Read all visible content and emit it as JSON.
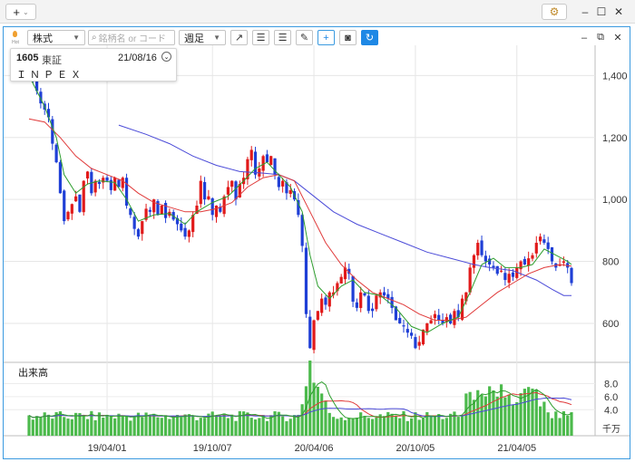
{
  "titlebar": {
    "add_label": "+",
    "add_caret": "⌄",
    "window_buttons": [
      "–",
      "☐",
      "✕"
    ]
  },
  "toolbar": {
    "hot_label": "Hot",
    "market_select": "株式",
    "search_placeholder": "銘柄名 or コード",
    "period_select": "週足",
    "panel_buttons": [
      "–",
      "⧉",
      "✕"
    ]
  },
  "info": {
    "code": "1605",
    "market": "東証",
    "date": "21/08/16",
    "name": "ＩＮＰＥＸ"
  },
  "volume_panel": {
    "label": "出来高",
    "unit": "千万",
    "ticks": [
      "8.0",
      "6.0",
      "4.0"
    ]
  },
  "colors": {
    "up_candle": "#e11a1a",
    "down_candle": "#1f3fd6",
    "ma_short": "#2e9e2e",
    "ma_mid": "#e03a3a",
    "ma_long": "#4b4bd8",
    "volume_bar": "#4cba4c",
    "accent": "#3a9ae0"
  },
  "chart_data": {
    "type": "candlestick",
    "y_ticks": [
      1400,
      1200,
      1000,
      800,
      600
    ],
    "ylim": [
      480,
      1480
    ],
    "x_ticks": [
      {
        "label": "19/04/01",
        "index": 20
      },
      {
        "label": "19/10/07",
        "index": 47
      },
      {
        "label": "20/04/06",
        "index": 73
      },
      {
        "label": "20/10/05",
        "index": 99
      },
      {
        "label": "21/04/05",
        "index": 125
      }
    ],
    "close_path": [
      [
        0,
        1410
      ],
      [
        1,
        1380
      ],
      [
        2,
        1350
      ],
      [
        3,
        1310
      ],
      [
        4,
        1290
      ],
      [
        5,
        1265
      ],
      [
        6,
        1180
      ],
      [
        7,
        1120
      ],
      [
        8,
        1020
      ],
      [
        9,
        930
      ],
      [
        10,
        960
      ],
      [
        11,
        985
      ],
      [
        12,
        1010
      ],
      [
        13,
        960
      ],
      [
        14,
        1060
      ],
      [
        15,
        1090
      ],
      [
        16,
        1020
      ],
      [
        17,
        1060
      ],
      [
        18,
        1050
      ],
      [
        19,
        1070
      ],
      [
        20,
        1060
      ],
      [
        21,
        1030
      ],
      [
        22,
        1070
      ],
      [
        23,
        1040
      ],
      [
        24,
        1070
      ],
      [
        25,
        980
      ],
      [
        26,
        950
      ],
      [
        27,
        905
      ],
      [
        28,
        880
      ],
      [
        29,
        930
      ],
      [
        30,
        970
      ],
      [
        31,
        960
      ],
      [
        32,
        1000
      ],
      [
        33,
        950
      ],
      [
        34,
        980
      ],
      [
        35,
        940
      ],
      [
        36,
        960
      ],
      [
        37,
        935
      ],
      [
        38,
        920
      ],
      [
        39,
        900
      ],
      [
        40,
        880
      ],
      [
        41,
        900
      ],
      [
        42,
        950
      ],
      [
        43,
        980
      ],
      [
        44,
        1060
      ],
      [
        45,
        1000
      ],
      [
        46,
        1010
      ],
      [
        47,
        950
      ],
      [
        48,
        980
      ],
      [
        49,
        960
      ],
      [
        50,
        1010
      ],
      [
        51,
        1040
      ],
      [
        52,
        1060
      ],
      [
        53,
        1000
      ],
      [
        54,
        1050
      ],
      [
        55,
        1070
      ],
      [
        56,
        1130
      ],
      [
        57,
        1160
      ],
      [
        58,
        1080
      ],
      [
        59,
        1100
      ],
      [
        60,
        1140
      ],
      [
        61,
        1120
      ],
      [
        62,
        1140
      ],
      [
        63,
        1080
      ],
      [
        64,
        1040
      ],
      [
        65,
        1060
      ],
      [
        66,
        1020
      ],
      [
        67,
        1030
      ],
      [
        68,
        1000
      ],
      [
        69,
        950
      ],
      [
        70,
        850
      ],
      [
        71,
        630
      ],
      [
        72,
        520
      ],
      [
        73,
        610
      ],
      [
        74,
        640
      ],
      [
        75,
        680
      ],
      [
        76,
        660
      ],
      [
        77,
        700
      ],
      [
        78,
        700
      ],
      [
        79,
        730
      ],
      [
        80,
        750
      ],
      [
        81,
        780
      ],
      [
        82,
        760
      ],
      [
        83,
        670
      ],
      [
        84,
        650
      ],
      [
        85,
        700
      ],
      [
        86,
        690
      ],
      [
        87,
        640
      ],
      [
        88,
        640
      ],
      [
        89,
        690
      ],
      [
        90,
        700
      ],
      [
        91,
        690
      ],
      [
        92,
        680
      ],
      [
        93,
        650
      ],
      [
        94,
        610
      ],
      [
        95,
        600
      ],
      [
        96,
        590
      ],
      [
        97,
        570
      ],
      [
        98,
        560
      ],
      [
        99,
        520
      ],
      [
        100,
        540
      ],
      [
        101,
        580
      ],
      [
        102,
        600
      ],
      [
        103,
        610
      ],
      [
        104,
        630
      ],
      [
        105,
        610
      ],
      [
        106,
        600
      ],
      [
        107,
        620
      ],
      [
        108,
        600
      ],
      [
        109,
        640
      ],
      [
        110,
        620
      ],
      [
        111,
        680
      ],
      [
        112,
        700
      ],
      [
        113,
        780
      ],
      [
        114,
        820
      ],
      [
        115,
        860
      ],
      [
        116,
        820
      ],
      [
        117,
        800
      ],
      [
        118,
        790
      ],
      [
        119,
        780
      ],
      [
        120,
        760
      ],
      [
        121,
        770
      ],
      [
        122,
        740
      ],
      [
        123,
        760
      ],
      [
        124,
        750
      ],
      [
        125,
        780
      ],
      [
        126,
        800
      ],
      [
        127,
        790
      ],
      [
        128,
        810
      ],
      [
        129,
        820
      ],
      [
        130,
        860
      ],
      [
        131,
        880
      ],
      [
        132,
        860
      ],
      [
        133,
        840
      ],
      [
        134,
        800
      ],
      [
        135,
        780
      ],
      [
        136,
        790
      ],
      [
        137,
        800
      ],
      [
        138,
        780
      ],
      [
        139,
        730
      ]
    ],
    "ma_short_path": [
      [
        0,
        1400
      ],
      [
        4,
        1300
      ],
      [
        7,
        1200
      ],
      [
        9,
        1080
      ],
      [
        12,
        1020
      ],
      [
        15,
        1050
      ],
      [
        18,
        1060
      ],
      [
        22,
        1055
      ],
      [
        25,
        1000
      ],
      [
        28,
        930
      ],
      [
        32,
        950
      ],
      [
        36,
        955
      ],
      [
        40,
        920
      ],
      [
        43,
        960
      ],
      [
        47,
        990
      ],
      [
        51,
        1010
      ],
      [
        55,
        1060
      ],
      [
        58,
        1100
      ],
      [
        61,
        1120
      ],
      [
        64,
        1080
      ],
      [
        67,
        1040
      ],
      [
        70,
        960
      ],
      [
        72,
        820
      ],
      [
        74,
        720
      ],
      [
        77,
        680
      ],
      [
        80,
        720
      ],
      [
        83,
        740
      ],
      [
        86,
        700
      ],
      [
        90,
        690
      ],
      [
        94,
        650
      ],
      [
        98,
        590
      ],
      [
        102,
        570
      ],
      [
        106,
        600
      ],
      [
        110,
        620
      ],
      [
        113,
        700
      ],
      [
        116,
        790
      ],
      [
        119,
        810
      ],
      [
        122,
        780
      ],
      [
        126,
        780
      ],
      [
        129,
        790
      ],
      [
        132,
        840
      ],
      [
        135,
        820
      ],
      [
        138,
        800
      ],
      [
        139,
        790
      ]
    ],
    "ma_mid_path": [
      [
        0,
        1260
      ],
      [
        4,
        1250
      ],
      [
        8,
        1200
      ],
      [
        12,
        1140
      ],
      [
        16,
        1100
      ],
      [
        20,
        1080
      ],
      [
        24,
        1060
      ],
      [
        28,
        1020
      ],
      [
        32,
        990
      ],
      [
        36,
        975
      ],
      [
        40,
        960
      ],
      [
        44,
        960
      ],
      [
        48,
        970
      ],
      [
        52,
        990
      ],
      [
        56,
        1040
      ],
      [
        60,
        1070
      ],
      [
        64,
        1080
      ],
      [
        68,
        1060
      ],
      [
        72,
        960
      ],
      [
        76,
        860
      ],
      [
        80,
        790
      ],
      [
        84,
        740
      ],
      [
        88,
        700
      ],
      [
        92,
        680
      ],
      [
        96,
        660
      ],
      [
        100,
        630
      ],
      [
        104,
        610
      ],
      [
        108,
        610
      ],
      [
        112,
        620
      ],
      [
        116,
        660
      ],
      [
        120,
        700
      ],
      [
        124,
        730
      ],
      [
        128,
        760
      ],
      [
        132,
        780
      ],
      [
        136,
        790
      ],
      [
        139,
        785
      ]
    ],
    "ma_long_path": [
      [
        23,
        1240
      ],
      [
        30,
        1210
      ],
      [
        36,
        1180
      ],
      [
        42,
        1140
      ],
      [
        48,
        1110
      ],
      [
        54,
        1090
      ],
      [
        60,
        1085
      ],
      [
        64,
        1080
      ],
      [
        68,
        1060
      ],
      [
        72,
        1020
      ],
      [
        78,
        960
      ],
      [
        84,
        920
      ],
      [
        90,
        890
      ],
      [
        96,
        860
      ],
      [
        102,
        830
      ],
      [
        108,
        810
      ],
      [
        114,
        790
      ],
      [
        118,
        780
      ],
      [
        124,
        770
      ],
      [
        130,
        740
      ],
      [
        134,
        710
      ],
      [
        137,
        690
      ],
      [
        139,
        690
      ]
    ],
    "volume_ticks": [
      8.0,
      6.0,
      4.0
    ],
    "volume_ylim": [
      0,
      11
    ]
  }
}
